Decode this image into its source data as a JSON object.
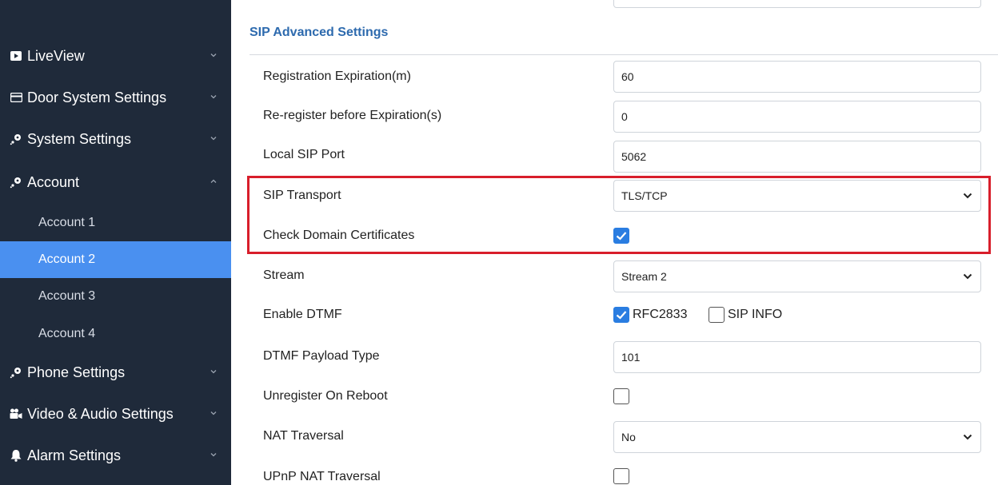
{
  "sidebar": {
    "items": [
      {
        "label": "LiveView",
        "icon": "play-icon",
        "expanded": false
      },
      {
        "label": "Door System Settings",
        "icon": "card-icon",
        "expanded": false
      },
      {
        "label": "System Settings",
        "icon": "key-icon",
        "expanded": false
      },
      {
        "label": "Account",
        "icon": "key-icon",
        "expanded": true
      },
      {
        "label": "Account 1"
      },
      {
        "label": "Account 2",
        "active": true
      },
      {
        "label": "Account 3"
      },
      {
        "label": "Account 4"
      },
      {
        "label": "Phone Settings",
        "icon": "key-icon",
        "expanded": false
      },
      {
        "label": "Video & Audio Settings",
        "icon": "camera-icon",
        "expanded": false
      },
      {
        "label": "Alarm Settings",
        "icon": "bell-icon",
        "expanded": false
      }
    ]
  },
  "section": {
    "title": "SIP Advanced Settings"
  },
  "settings": {
    "registration_expiration": {
      "label": "Registration Expiration(m)",
      "value": "60"
    },
    "reregister_before_expiration": {
      "label": "Re-register before Expiration(s)",
      "value": "0"
    },
    "local_sip_port": {
      "label": "Local SIP Port",
      "value": "5062"
    },
    "sip_transport": {
      "label": "SIP Transport",
      "value": "TLS/TCP"
    },
    "check_domain_certificates": {
      "label": "Check Domain Certificates",
      "checked": true
    },
    "stream": {
      "label": "Stream",
      "value": "Stream 2"
    },
    "enable_dtmf": {
      "label": "Enable DTMF",
      "options": [
        {
          "label": "RFC2833",
          "checked": true
        },
        {
          "label": "SIP INFO",
          "checked": false
        }
      ]
    },
    "dtmf_payload_type": {
      "label": "DTMF Payload Type",
      "value": "101"
    },
    "unregister_on_reboot": {
      "label": "Unregister On Reboot",
      "checked": false
    },
    "nat_traversal": {
      "label": "NAT Traversal",
      "value": "No"
    },
    "upnp_nat_traversal": {
      "label": "UPnP NAT Traversal",
      "checked": false
    }
  },
  "colors": {
    "sidebar_bg": "#1f2a3a",
    "active_item": "#4a90f0",
    "accent": "#2a7de1",
    "highlight_box": "#d81e2b",
    "section_title": "#2d6aae"
  }
}
